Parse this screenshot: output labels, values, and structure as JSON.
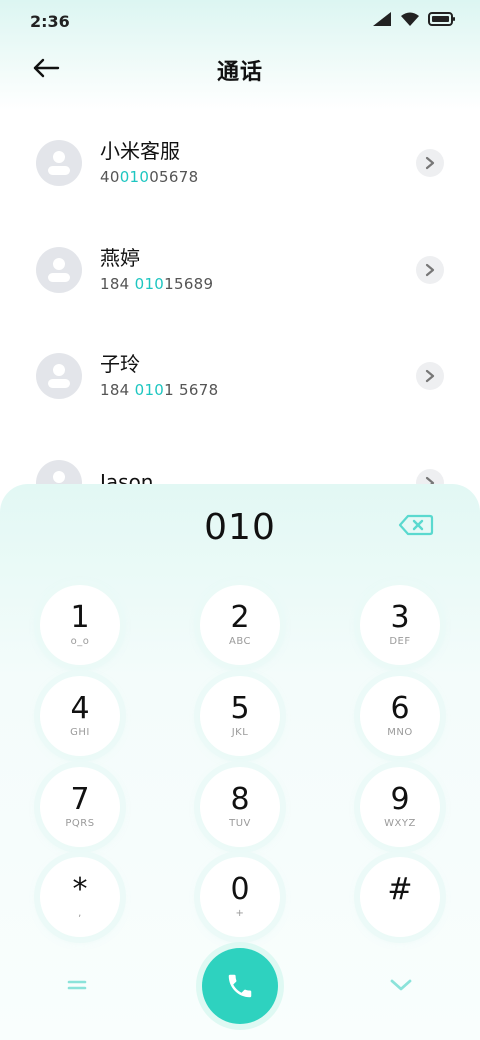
{
  "status_bar": {
    "time": "2:36",
    "icons": [
      "signal-icon",
      "wifi-icon",
      "battery-icon"
    ]
  },
  "header": {
    "title": "通话",
    "back_icon": "arrow-left-icon"
  },
  "contacts": [
    {
      "name": "小米客服",
      "number_pre": "40",
      "number_match": "010",
      "number_post": "05678"
    },
    {
      "name": "燕婷",
      "number_pre": "184 ",
      "number_match": "010",
      "number_post": "15689"
    },
    {
      "name": "子玲",
      "number_pre": "184 ",
      "number_match": "010",
      "number_post": "1 5678"
    },
    {
      "name": "Jason",
      "number_pre": "",
      "number_match": "",
      "number_post": ""
    }
  ],
  "dialer": {
    "input": "010",
    "keys": [
      {
        "digit": "1",
        "letters": "o_o"
      },
      {
        "digit": "2",
        "letters": "ABC"
      },
      {
        "digit": "3",
        "letters": "DEF"
      },
      {
        "digit": "4",
        "letters": "GHI"
      },
      {
        "digit": "5",
        "letters": "JKL"
      },
      {
        "digit": "6",
        "letters": "MNO"
      },
      {
        "digit": "7",
        "letters": "PQRS"
      },
      {
        "digit": "8",
        "letters": "TUV"
      },
      {
        "digit": "9",
        "letters": "WXYZ"
      },
      {
        "digit": "*",
        "letters": ","
      },
      {
        "digit": "0",
        "letters": "+"
      },
      {
        "digit": "#",
        "letters": ""
      }
    ]
  },
  "colors": {
    "accent": "#1ec6c1",
    "call_button": "#2ed2bf",
    "avatar_bg": "#e3e5ea"
  }
}
